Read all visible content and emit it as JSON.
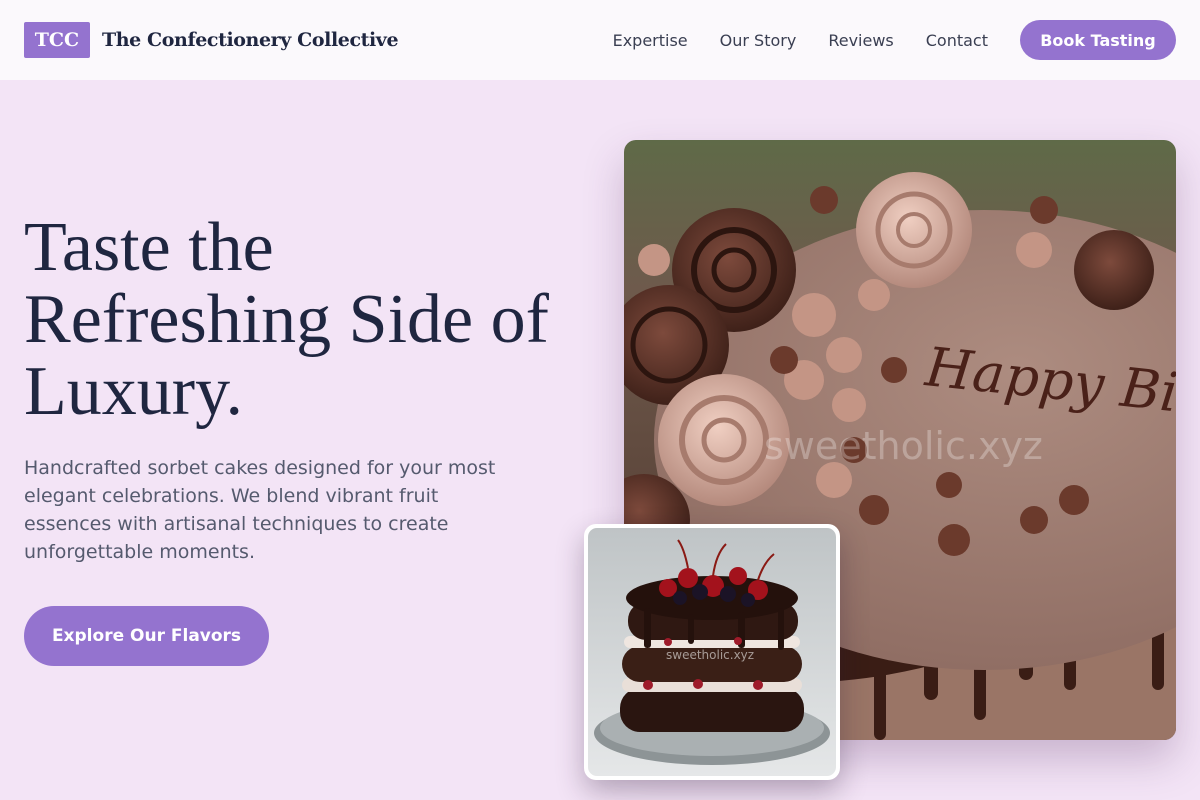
{
  "header": {
    "logo_text": "TCC",
    "brand_name": "The Confectionery Collective",
    "nav": [
      {
        "label": "Expertise"
      },
      {
        "label": "Our Story"
      },
      {
        "label": "Reviews"
      },
      {
        "label": "Contact"
      }
    ],
    "cta_label": "Book Tasting"
  },
  "hero": {
    "title_lines": [
      "Taste the",
      "Refreshing Side of",
      "Luxury."
    ],
    "subtitle_lines": [
      "Handcrafted sorbet cakes designed for your most",
      "elegant celebrations. We blend vibrant fruit",
      "essences with artisanal techniques to create",
      "unforgettable moments."
    ],
    "cta_label": "Explore Our Flavors"
  },
  "images": {
    "main": {
      "cake_inscription": "Happy Birthday",
      "watermark": "sweetholic.xyz"
    },
    "thumbnail": {
      "watermark": "sweetholic.xyz"
    }
  },
  "colors": {
    "accent": "#9473cf",
    "page_background": "#f3e4f6",
    "header_background": "#fbf9fc",
    "heading_text": "#1f2640",
    "body_text": "#555a6e"
  }
}
